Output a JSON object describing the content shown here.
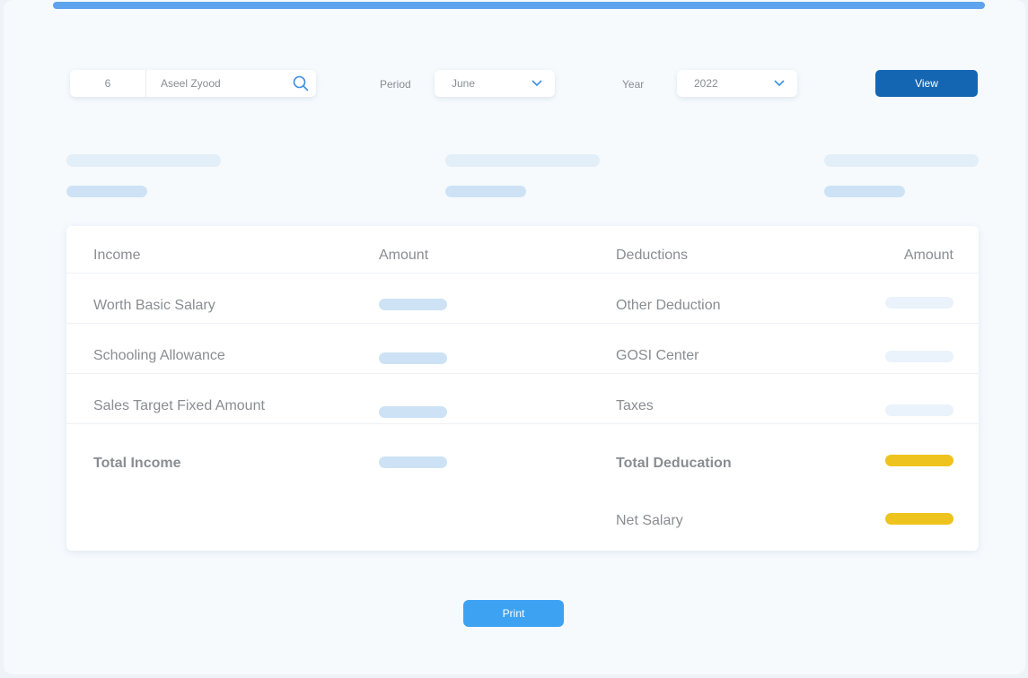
{
  "filters": {
    "employee_id": "6",
    "employee_name": "Aseel Zyood",
    "period_label": "Period",
    "period_value": "June",
    "year_label": "Year",
    "year_value": "2022",
    "view_label": "View"
  },
  "table": {
    "headers": {
      "income": "Income",
      "income_amount": "Amount",
      "deductions": "Deductions",
      "deductions_amount": "Amount"
    },
    "income_rows": [
      "Worth Basic Salary",
      "Schooling Allowance",
      "Sales Target Fixed Amount"
    ],
    "deduction_rows": [
      "Other Deduction",
      "GOSI Center",
      "Taxes"
    ],
    "total_income_label": "Total Income",
    "total_deduction_label": "Total Deducation",
    "net_salary_label": "Net Salary"
  },
  "actions": {
    "print_label": "Print"
  },
  "colors": {
    "primary": "#1566b2",
    "accent_blue": "#3ea2f3",
    "highlight": "#eec31d",
    "placeholder": "#cde3f5"
  },
  "icons": {
    "search": "search-icon",
    "dropdown": "chevron-down-icon"
  }
}
